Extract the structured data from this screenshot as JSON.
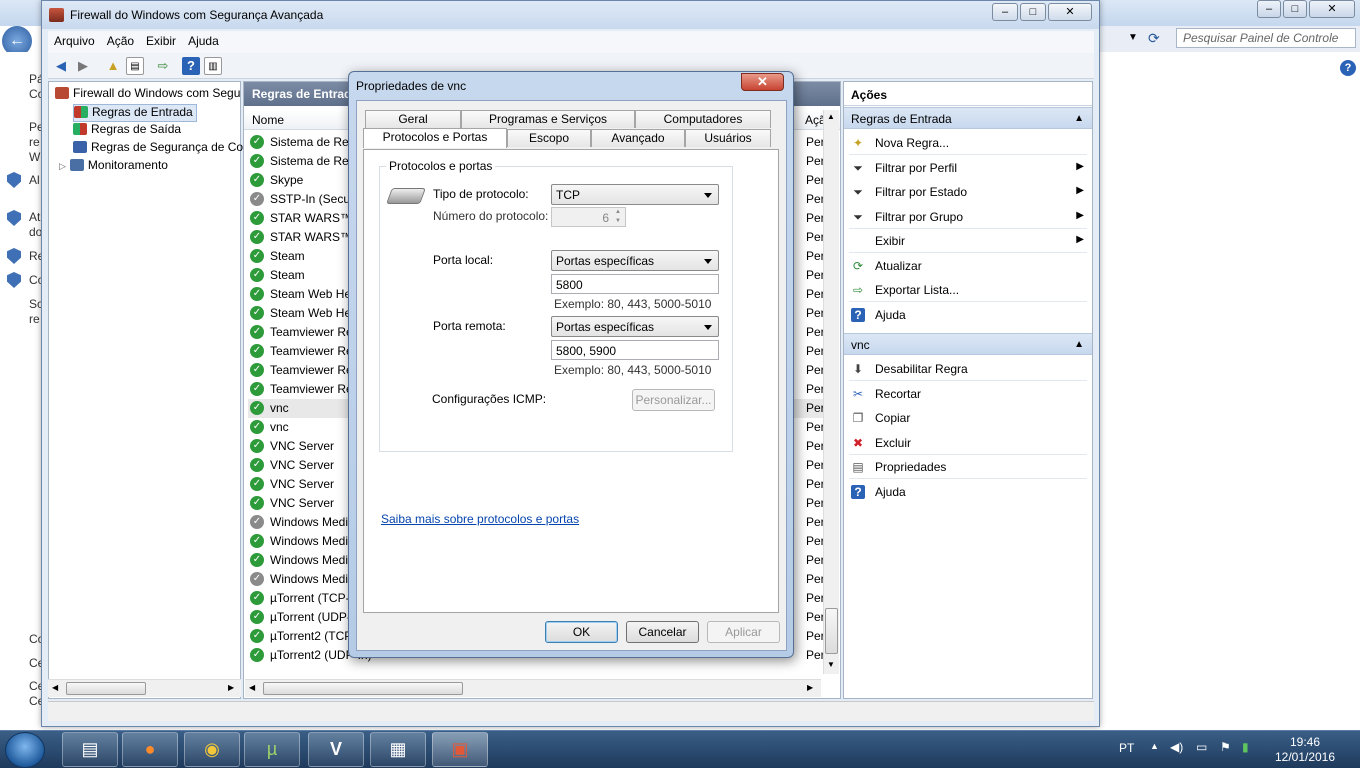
{
  "background_window": {
    "search_placeholder": "Pesquisar Painel de Controle",
    "left_snips": [
      "Pá",
      "Co",
      "Pe",
      "re",
      "W",
      "Al",
      "Ati",
      "do",
      "Re",
      "Co",
      "So",
      "re",
      "Co",
      "Ce",
      "Ce",
      "Ce"
    ]
  },
  "firewall": {
    "title": "Firewall do Windows com Segurança Avançada",
    "menu": [
      "Arquivo",
      "Ação",
      "Exibir",
      "Ajuda"
    ],
    "tree": [
      {
        "label": "Firewall do Windows com Segu",
        "level": 0
      },
      {
        "label": "Regras de Entrada",
        "level": 1,
        "selected": true
      },
      {
        "label": "Regras de Saída",
        "level": 1
      },
      {
        "label": "Regras de Segurança de Cor",
        "level": 1
      },
      {
        "label": "Monitoramento",
        "level": 1
      }
    ],
    "mid_header": "Regras de Entrada",
    "col_name": "Nome",
    "col_action": "Açã",
    "rules": [
      {
        "name": "Sistema de Red",
        "action": "Per",
        "enabled": true
      },
      {
        "name": "Sistema de Red",
        "action": "Per",
        "enabled": true
      },
      {
        "name": "Skype",
        "action": "Per",
        "enabled": true
      },
      {
        "name": "SSTP-In (Secure",
        "action": "Per",
        "enabled": false
      },
      {
        "name": "STAR WARS™ B",
        "action": "Per",
        "enabled": true
      },
      {
        "name": "STAR WARS™ B",
        "action": "Per",
        "enabled": true
      },
      {
        "name": "Steam",
        "action": "Per",
        "enabled": true
      },
      {
        "name": "Steam",
        "action": "Per",
        "enabled": true
      },
      {
        "name": "Steam Web Hel",
        "action": "Per",
        "enabled": true
      },
      {
        "name": "Steam Web Hel",
        "action": "Per",
        "enabled": true
      },
      {
        "name": "Teamviewer Re",
        "action": "Per",
        "enabled": true
      },
      {
        "name": "Teamviewer Re",
        "action": "Per",
        "enabled": true
      },
      {
        "name": "Teamviewer Re",
        "action": "Per",
        "enabled": true
      },
      {
        "name": "Teamviewer Re",
        "action": "Per",
        "enabled": true
      },
      {
        "name": "vnc",
        "action": "Per",
        "enabled": true,
        "selected": true
      },
      {
        "name": "vnc",
        "action": "Per",
        "enabled": true
      },
      {
        "name": "VNC Server",
        "action": "Per",
        "enabled": true
      },
      {
        "name": "VNC Server",
        "action": "Per",
        "enabled": true
      },
      {
        "name": "VNC Server",
        "action": "Per",
        "enabled": true
      },
      {
        "name": "VNC Server",
        "action": "Per",
        "enabled": true
      },
      {
        "name": "Windows Medi",
        "action": "Per",
        "enabled": false
      },
      {
        "name": "Windows Medi",
        "action": "Per",
        "enabled": true
      },
      {
        "name": "Windows Medi",
        "action": "Per",
        "enabled": true
      },
      {
        "name": "Windows Medi",
        "action": "Per",
        "enabled": false
      },
      {
        "name": "µTorrent (TCP-",
        "action": "Per",
        "enabled": true
      },
      {
        "name": "µTorrent (UDP-",
        "action": "Per",
        "enabled": true
      },
      {
        "name": "µTorrent2 (TCP",
        "action": "Per",
        "enabled": true
      },
      {
        "name": "µTorrent2 (UDP-In)",
        "action": "Per",
        "enabled": true
      }
    ],
    "actions_title": "Ações",
    "section1": "Regras de Entrada",
    "section1_items": [
      {
        "label": "Nova Regra...",
        "icon": "new-rule-icon",
        "arrow": false
      },
      {
        "label": "Filtrar por Perfil",
        "icon": "filter-icon",
        "arrow": true
      },
      {
        "label": "Filtrar por Estado",
        "icon": "filter-icon",
        "arrow": true
      },
      {
        "label": "Filtrar por Grupo",
        "icon": "filter-icon",
        "arrow": true
      },
      {
        "label": "Exibir",
        "icon": "view-icon",
        "arrow": true
      },
      {
        "label": "Atualizar",
        "icon": "refresh-icon",
        "arrow": false
      },
      {
        "label": "Exportar Lista...",
        "icon": "export-icon",
        "arrow": false
      },
      {
        "label": "Ajuda",
        "icon": "help-icon",
        "arrow": false
      }
    ],
    "section2": "vnc",
    "section2_items": [
      {
        "label": "Desabilitar Regra",
        "icon": "disable-icon"
      },
      {
        "label": "Recortar",
        "icon": "cut-icon"
      },
      {
        "label": "Copiar",
        "icon": "copy-icon"
      },
      {
        "label": "Excluir",
        "icon": "delete-icon"
      },
      {
        "label": "Propriedades",
        "icon": "properties-icon"
      },
      {
        "label": "Ajuda",
        "icon": "help-icon"
      }
    ]
  },
  "dialog": {
    "title": "Propriedades de vnc",
    "close": "✕",
    "tabs_row1": [
      "Geral",
      "Programas e Serviços",
      "Computadores"
    ],
    "tabs_row2": [
      "Protocolos e Portas",
      "Escopo",
      "Avançado",
      "Usuários"
    ],
    "group_label": "Protocolos e portas",
    "protocol_type_label": "Tipo de protocolo:",
    "protocol_type_value": "TCP",
    "protocol_number_label": "Número do protocolo:",
    "protocol_number_value": "6",
    "local_port_label": "Porta local:",
    "local_port_mode": "Portas específicas",
    "local_port_value": "5800",
    "local_port_hint": "Exemplo: 80, 443, 5000-5010",
    "remote_port_label": "Porta remota:",
    "remote_port_mode": "Portas específicas",
    "remote_port_value": "5800, 5900",
    "remote_port_hint": "Exemplo: 80, 443, 5000-5010",
    "icmp_label": "Configurações ICMP:",
    "icmp_button": "Personalizar...",
    "link": "Saiba mais sobre protocolos e portas",
    "ok": "OK",
    "cancel": "Cancelar",
    "apply": "Aplicar"
  },
  "taskbar": {
    "lang": "PT",
    "time": "19:46",
    "date": "12/01/2016"
  }
}
